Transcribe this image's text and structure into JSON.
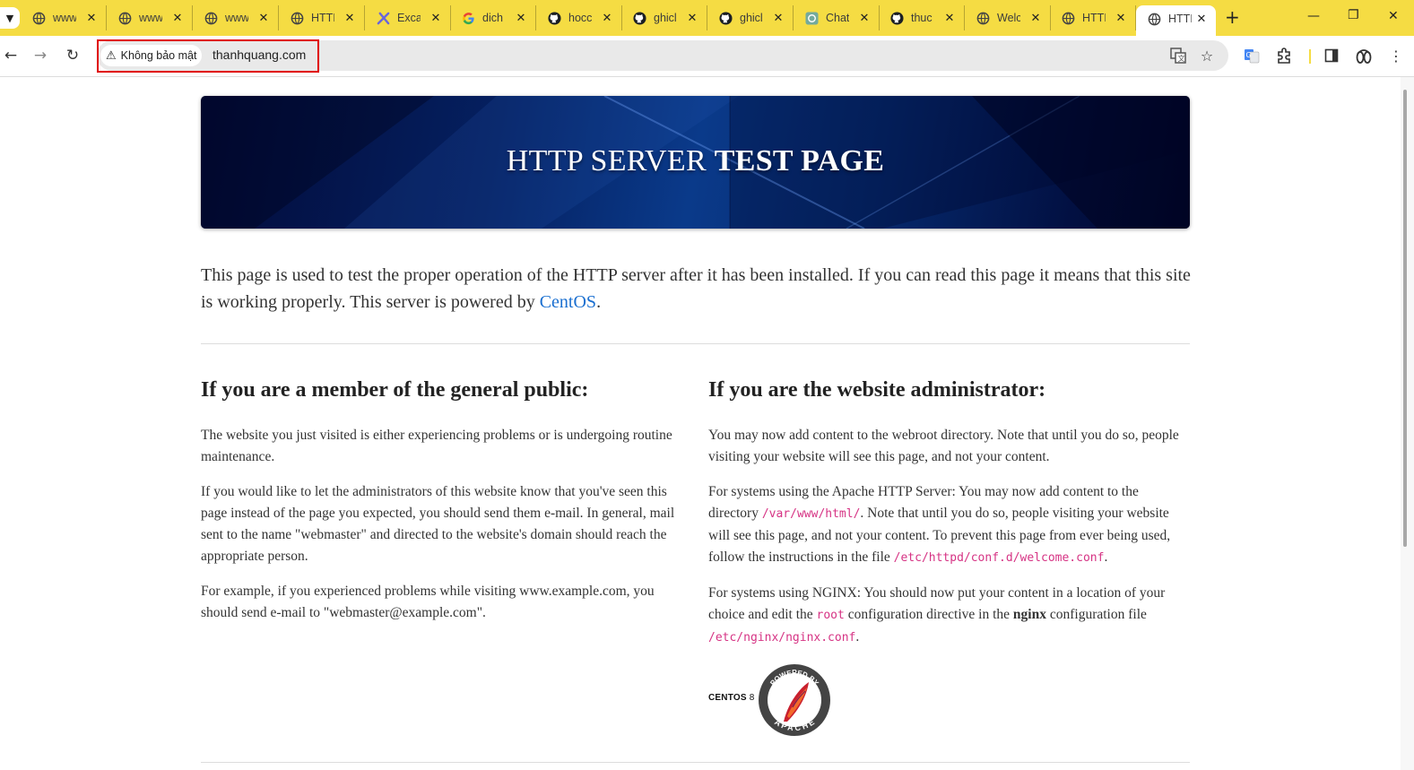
{
  "browser": {
    "tabs": [
      {
        "title": "www",
        "icon": "globe-icon"
      },
      {
        "title": "www",
        "icon": "globe-icon"
      },
      {
        "title": "www",
        "icon": "globe-icon"
      },
      {
        "title": "HTTI",
        "icon": "globe-icon"
      },
      {
        "title": "Excal",
        "icon": "excalidraw-icon"
      },
      {
        "title": "dich",
        "icon": "google-icon"
      },
      {
        "title": "hocc",
        "icon": "github-icon"
      },
      {
        "title": "ghicl",
        "icon": "github-icon"
      },
      {
        "title": "ghicl",
        "icon": "github-icon"
      },
      {
        "title": "Chat",
        "icon": "chatgpt-icon"
      },
      {
        "title": "thuc",
        "icon": "github-icon"
      },
      {
        "title": "Welc",
        "icon": "globe-icon"
      },
      {
        "title": "HTTI",
        "icon": "globe-icon"
      },
      {
        "title": "HTTI",
        "icon": "globe-icon"
      }
    ],
    "security_label": "Không bảo mật",
    "url": "thanhquang.com",
    "colors": {
      "tabbar": "#f5dc43",
      "highlight_box": "#e00000"
    }
  },
  "page": {
    "hero_title_normal": "HTTP SERVER ",
    "hero_title_bold": "TEST PAGE",
    "intro_text": "This page is used to test the proper operation of the HTTP server after it has been installed. If you can read this page it means that this site is working properly. This server is powered by ",
    "intro_link": "CentOS",
    "intro_end": ".",
    "public": {
      "heading": "If you are a member of the general public:",
      "p1": "The website you just visited is either experiencing problems or is undergoing routine maintenance.",
      "p2": "If you would like to let the administrators of this website know that you've seen this page instead of the page you expected, you should send them e-mail. In general, mail sent to the name \"webmaster\" and directed to the website's domain should reach the appropriate person.",
      "p3": "For example, if you experienced problems while visiting www.example.com, you should send e-mail to \"webmaster@example.com\"."
    },
    "admin": {
      "heading": "If you are the website administrator:",
      "p1": "You may now add content to the webroot directory. Note that until you do so, people visiting your website will see this page, and not your content.",
      "p2_a": "For systems using the Apache HTTP Server: You may now add content to the directory ",
      "p2_code1": "/var/www/html/",
      "p2_b": ". Note that until you do so, people visiting your website will see this page, and not your content. To prevent this page from ever being used, follow the instructions in the file ",
      "p2_code2": "/etc/httpd/conf.d/welcome.conf",
      "p2_c": ".",
      "p3_a": "For systems using NGINX: You should now put your content in a location of your choice and edit the ",
      "p3_code1": "root",
      "p3_b": " configuration directive in the ",
      "p3_bold": "nginx",
      "p3_c": " configuration file ",
      "p3_code2": "/etc/nginx/nginx.conf",
      "p3_d": "."
    },
    "logo_centos": "CENTOS",
    "logo_centos_version": "8",
    "logo_apache_top": "POWERED BY",
    "logo_apache_bottom": "APACHE"
  }
}
